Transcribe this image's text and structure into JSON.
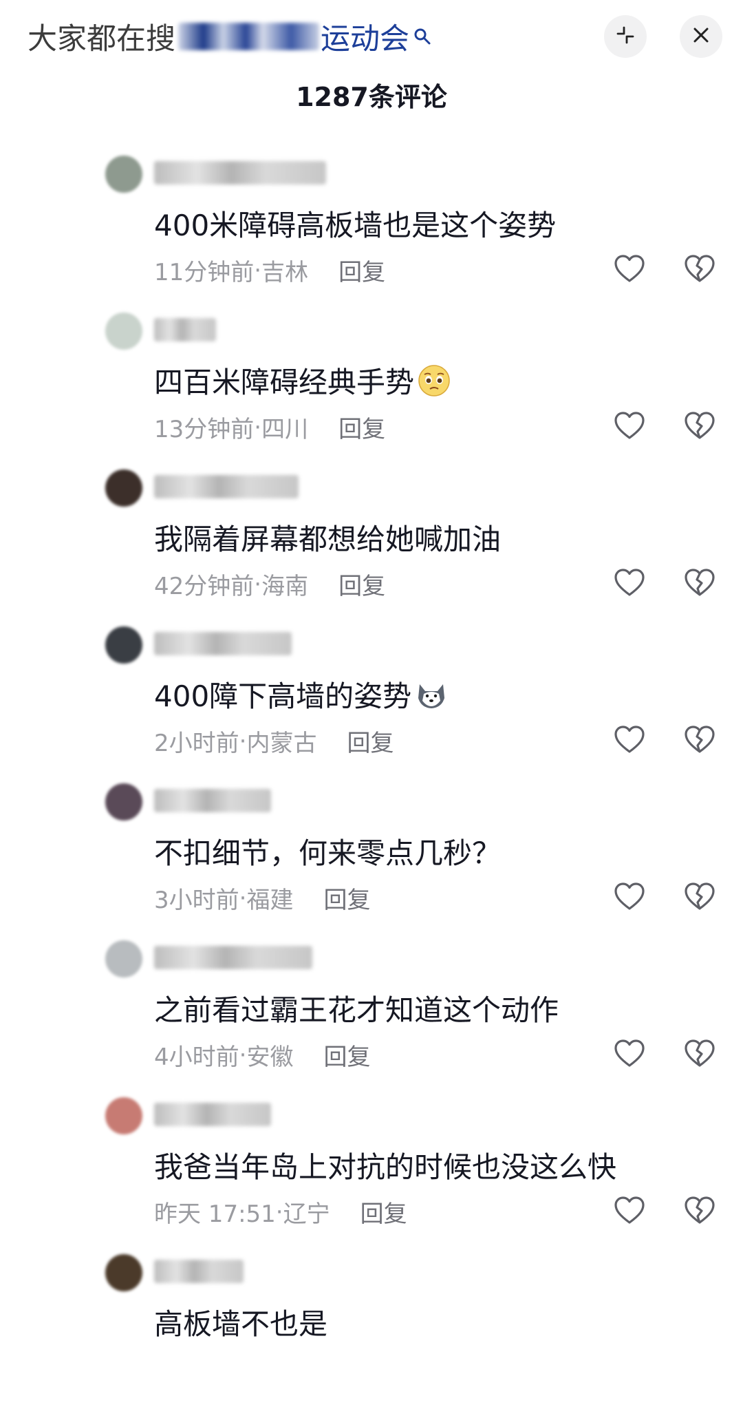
{
  "search_hint": {
    "prefix": "大家都在搜",
    "keyword": "运动会"
  },
  "header": {
    "comment_count": "1287条评论"
  },
  "comments": [
    {
      "text": "400米障碍高板墙也是这个姿势",
      "time": "11分钟前",
      "location": "吉林",
      "reply_label": "回复",
      "avatar_color": "#8e9a8f",
      "name_width": 250
    },
    {
      "text": "四百米障碍经典手势",
      "emoji": "pleading-face",
      "time": "13分钟前",
      "location": "四川",
      "reply_label": "回复",
      "avatar_color": "#c9d3cc",
      "name_width": 90
    },
    {
      "text": "我隔着屏幕都想给她喊加油",
      "time": "42分钟前",
      "location": "海南",
      "reply_label": "回复",
      "avatar_color": "#3c2f2a",
      "name_width": 210
    },
    {
      "text": "400障下高墙的姿势",
      "emoji": "husky-face",
      "time": "2小时前",
      "location": "内蒙古",
      "reply_label": "回复",
      "avatar_color": "#3a3e44",
      "name_width": 200
    },
    {
      "text": "不扣细节，何来零点几秒？",
      "time": "3小时前",
      "location": "福建",
      "reply_label": "回复",
      "avatar_color": "#5a4a58",
      "name_width": 170
    },
    {
      "text": "之前看过霸王花才知道这个动作",
      "time": "4小时前",
      "location": "安徽",
      "reply_label": "回复",
      "avatar_color": "#b8bcbf",
      "name_width": 230
    },
    {
      "text": "我爸当年岛上对抗的时候也没这么快",
      "time": "昨天 17:51",
      "location": "辽宁",
      "reply_label": "回复",
      "avatar_color": "#c77b73",
      "name_width": 170
    },
    {
      "text": "高板墙不也是",
      "time": "",
      "location": "",
      "reply_label": "",
      "avatar_color": "#4b3a2a",
      "name_width": 130
    }
  ],
  "colors": {
    "text_primary": "#161823",
    "text_secondary": "#9a9ba0",
    "reply": "#6f7077",
    "icon_stroke": "#5e5f66",
    "keyword": "#1d3f99"
  },
  "icons": {
    "collapse": "collapse-arrows-icon",
    "close": "close-icon",
    "like": "heart-outline-icon",
    "dislike": "broken-heart-outline-icon",
    "search": "search-icon"
  }
}
